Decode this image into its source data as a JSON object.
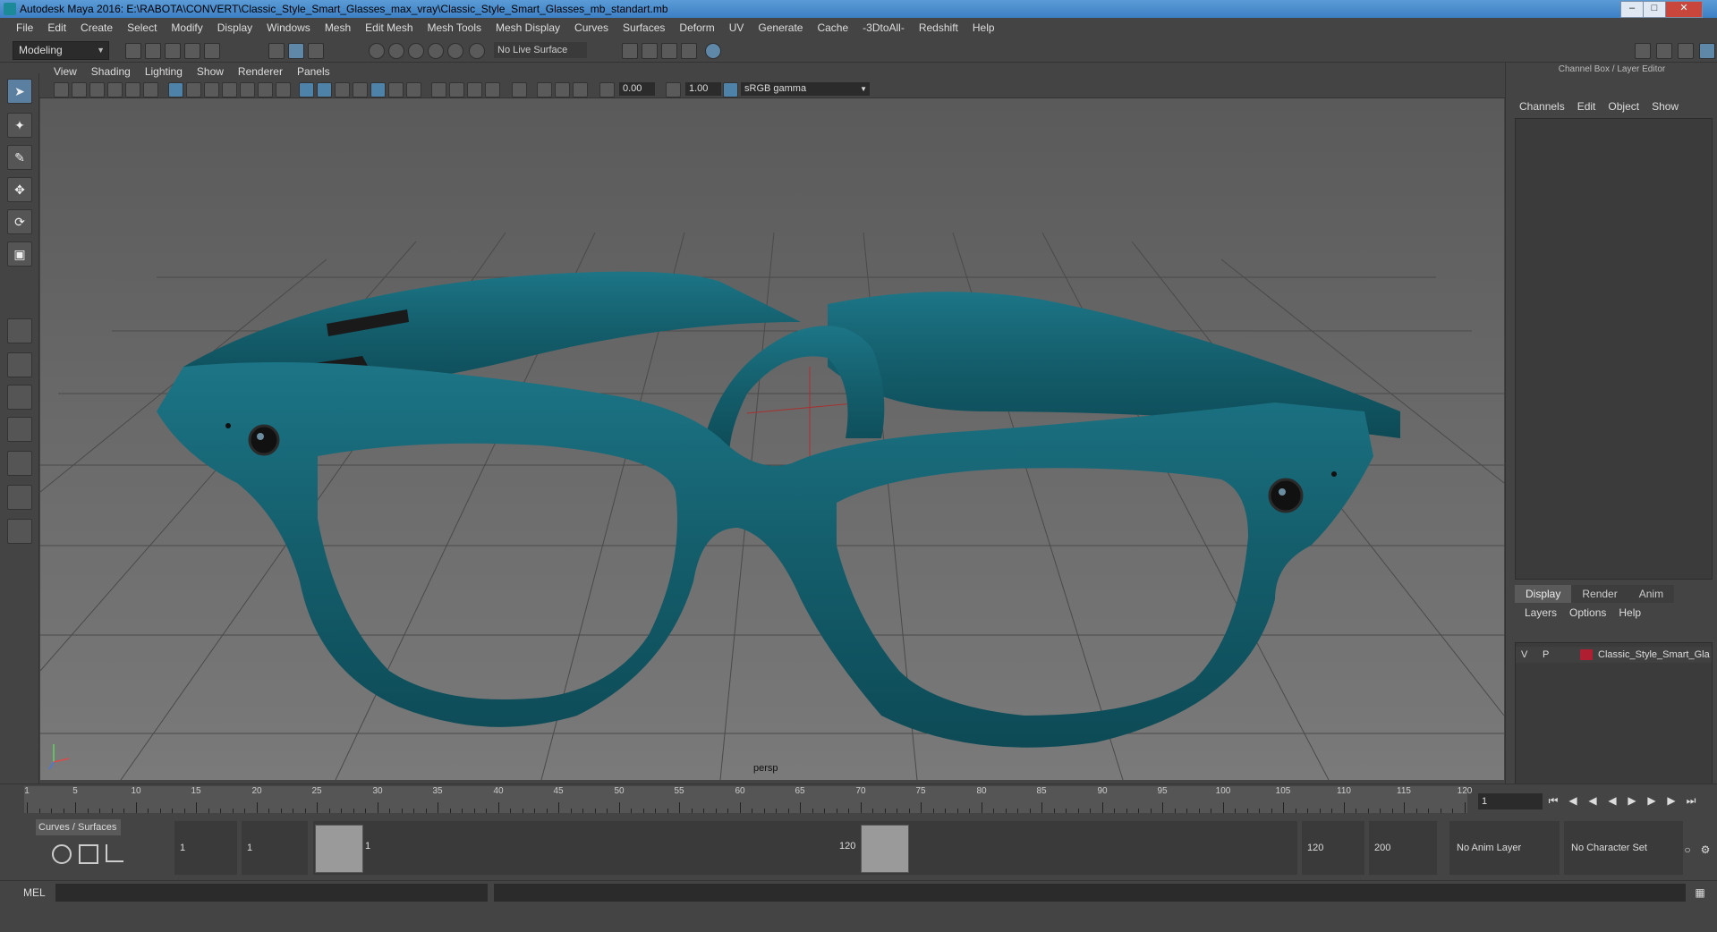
{
  "window": {
    "title": "Autodesk Maya 2016: E:\\RABOTA\\CONVERT\\Classic_Style_Smart_Glasses_max_vray\\Classic_Style_Smart_Glasses_mb_standart.mb",
    "minimize": "–",
    "maximize": "□",
    "close": "✕"
  },
  "menubar": [
    "File",
    "Edit",
    "Create",
    "Select",
    "Modify",
    "Display",
    "Windows",
    "Mesh",
    "Edit Mesh",
    "Mesh Tools",
    "Mesh Display",
    "Curves",
    "Surfaces",
    "Deform",
    "UV",
    "Generate",
    "Cache",
    "-3DtoAll-",
    "Redshift",
    "Help"
  ],
  "statusline": {
    "mode": "Modeling",
    "live_surface": "No Live Surface"
  },
  "viewport": {
    "menu": [
      "View",
      "Shading",
      "Lighting",
      "Show",
      "Renderer",
      "Panels"
    ],
    "exposure": "0.00",
    "gamma_value": "1.00",
    "color_space": "sRGB gamma",
    "camera_label": "persp",
    "model_color": "#145d6b"
  },
  "channel_box": {
    "title": "Channel Box / Layer Editor",
    "menu": [
      "Channels",
      "Edit",
      "Object",
      "Show"
    ]
  },
  "layer_editor": {
    "tabs": [
      "Display",
      "Render",
      "Anim"
    ],
    "menu": [
      "Layers",
      "Options",
      "Help"
    ],
    "layer": {
      "v": "V",
      "p": "P",
      "name": "Classic_Style_Smart_Glas",
      "color": "#b01e32"
    }
  },
  "timeline": {
    "ticks": [
      "1",
      "5",
      "10",
      "15",
      "20",
      "25",
      "30",
      "35",
      "40",
      "45",
      "50",
      "55",
      "60",
      "65",
      "70",
      "75",
      "80",
      "85",
      "90",
      "95",
      "100",
      "105",
      "110",
      "115",
      "120"
    ],
    "current_frame": "1"
  },
  "range": {
    "shelf_tab": "Curves / Surfaces",
    "start": "1",
    "playback_start": "1",
    "slider_start": "1",
    "slider_end": "120",
    "playback_end": "120",
    "end": "200",
    "anim_layer": "No Anim Layer",
    "character_set": "No Character Set"
  },
  "command_line": {
    "label": "MEL"
  }
}
